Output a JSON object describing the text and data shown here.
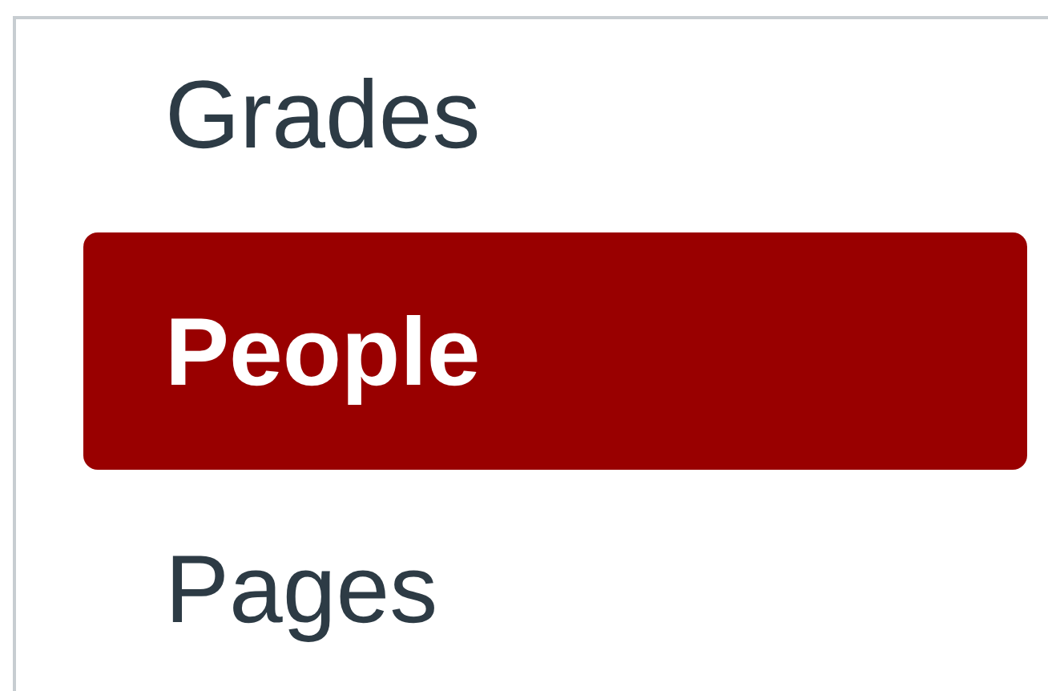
{
  "nav_items": [
    {
      "label": "Grades",
      "selected": false
    },
    {
      "label": "People",
      "selected": true
    },
    {
      "label": "Pages",
      "selected": false
    }
  ]
}
